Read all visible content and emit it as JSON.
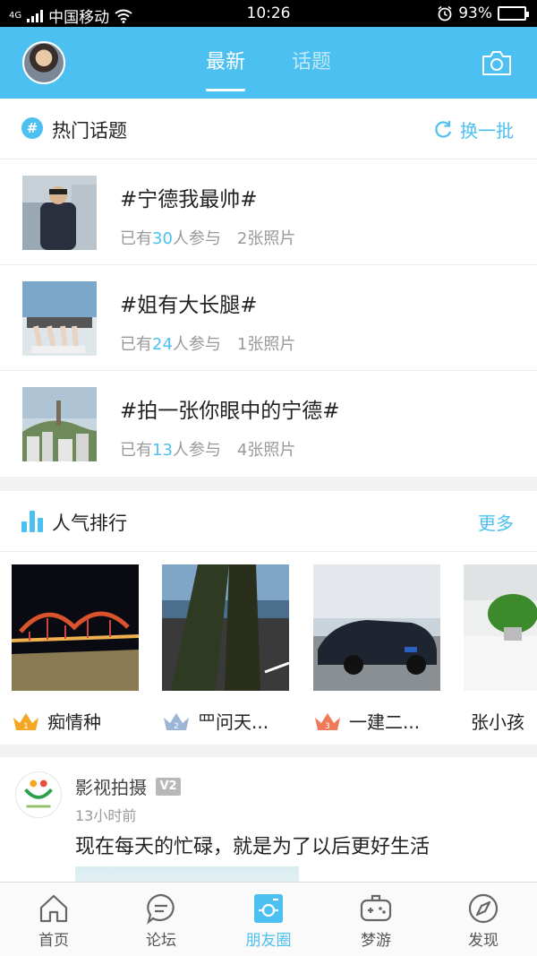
{
  "status_bar": {
    "carrier": "中国移动",
    "network": "4G",
    "time": "10:26",
    "battery": "93%",
    "battery_level": 0.93
  },
  "header": {
    "tabs": [
      {
        "label": "最新",
        "active": true
      },
      {
        "label": "话题",
        "active": false
      }
    ],
    "camera_icon": "camera-icon"
  },
  "hot_topics": {
    "title": "热门话题",
    "refresh_label": "换一批",
    "items": [
      {
        "name": "#宁德我最帅#",
        "prefix": "已有",
        "count": "30",
        "suffix": "人参与",
        "photos": "2张照片"
      },
      {
        "name": "#姐有大长腿#",
        "prefix": "已有",
        "count": "24",
        "suffix": "人参与",
        "photos": "1张照片"
      },
      {
        "name": "#拍一张你眼中的宁德#",
        "prefix": "已有",
        "count": "13",
        "suffix": "人参与",
        "photos": "4张照片"
      }
    ]
  },
  "popular": {
    "title": "人气排行",
    "more_label": "更多",
    "items": [
      {
        "name": "痴情种",
        "rank": "1",
        "crown_color": "#f5a623"
      },
      {
        "name": "罒问天...",
        "rank": "2",
        "crown_color": "#9bb5d6"
      },
      {
        "name": "一建二...",
        "rank": "3",
        "crown_color": "#f07b5a"
      },
      {
        "name": "张小孩",
        "rank": "",
        "crown_color": ""
      }
    ]
  },
  "post": {
    "author": "影视拍摄",
    "badge": "V2",
    "time": "13小时前",
    "text": "现在每天的忙碌，就是为了以后更好生活"
  },
  "nav": {
    "items": [
      {
        "label": "首页",
        "icon": "home-icon",
        "active": false
      },
      {
        "label": "论坛",
        "icon": "chat-icon",
        "active": false
      },
      {
        "label": "朋友圈",
        "icon": "moments-icon",
        "active": true
      },
      {
        "label": "梦游",
        "icon": "gamepad-icon",
        "active": false
      },
      {
        "label": "发现",
        "icon": "compass-icon",
        "active": false
      }
    ]
  },
  "colors": {
    "accent": "#4cc0f0",
    "header_bg": "#4cc0f0",
    "muted": "#999999"
  }
}
